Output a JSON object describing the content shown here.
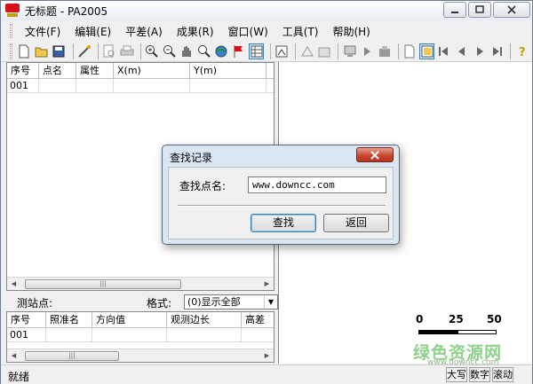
{
  "window": {
    "title": "无标题 - PA2005"
  },
  "menu": [
    {
      "label": "文件(F)"
    },
    {
      "label": "编辑(E)"
    },
    {
      "label": "平差(A)"
    },
    {
      "label": "成果(R)"
    },
    {
      "label": "窗口(W)"
    },
    {
      "label": "工具(T)"
    },
    {
      "label": "帮助(H)"
    }
  ],
  "toolbar": {
    "icons": [
      "new-file-icon",
      "open-folder-icon",
      "save-icon",
      "wand-icon",
      "print-preview-icon",
      "print-icon",
      "zoom-in-icon",
      "zoom-out-icon",
      "pan-hand-icon",
      "zoom-window-icon",
      "globe-icon",
      "flag-icon",
      "table-view-icon",
      "image-icon",
      "triangle-icon",
      "network-icon",
      "computer-icon",
      "play-icon",
      "building-icon",
      "blank-page-icon",
      "selected-view-icon",
      "first-icon",
      "prev-icon",
      "next-icon",
      "last-icon",
      "help-icon"
    ]
  },
  "table1": {
    "columns": [
      "序号",
      "点名",
      "属性",
      "X(m)",
      "Y(m)"
    ],
    "rows": [
      [
        "001",
        "",
        "",
        "",
        ""
      ]
    ]
  },
  "midbar": {
    "station_label": "测站点:",
    "format_label": "格式:",
    "format_value": "(0)显示全部"
  },
  "table2": {
    "columns": [
      "序号",
      "照准名",
      "方向值",
      "观测边长",
      "高差"
    ],
    "rows": [
      [
        "001",
        "",
        "",
        "",
        ""
      ]
    ]
  },
  "scale": {
    "labels": [
      "0",
      "25",
      "50"
    ]
  },
  "statusbar": {
    "text": "就绪",
    "cells": [
      "大写",
      "数字",
      "滚动"
    ]
  },
  "watermark": {
    "text": "绿色资源网",
    "sub": "www.downcc.com"
  },
  "dialog": {
    "title": "查找记录",
    "field_label": "查找点名:",
    "field_value": "www.downcc.com",
    "find_label": "查找",
    "back_label": "返回"
  },
  "colors": {
    "accent": "#3c7fb1",
    "title_close": "#c7462f",
    "dialog_bg": "#dbe6f3"
  }
}
